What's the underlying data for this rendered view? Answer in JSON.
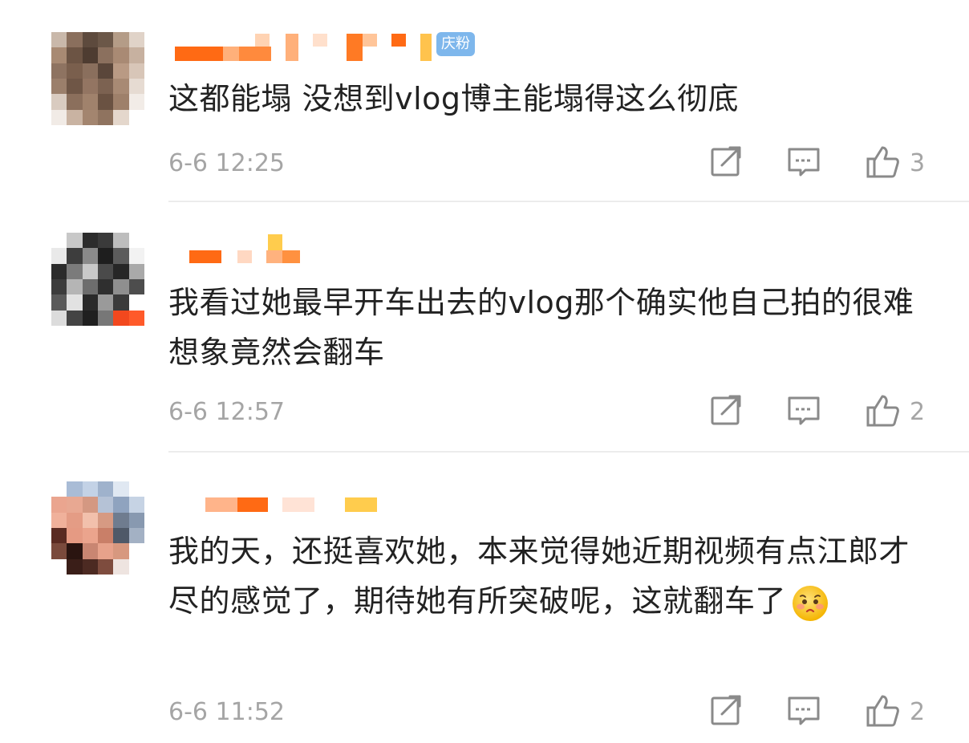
{
  "comments": [
    {
      "badge": "庆粉",
      "text": "这都能塌 没想到vlog博主能塌得这么彻底",
      "time": "6-6 12:25",
      "likes": "3"
    },
    {
      "text": "我看过她最早开车出去的vlog那个确实他自己拍的很难想象竟然会翻车",
      "time": "6-6 12:57",
      "likes": "2"
    },
    {
      "text": "我的天，还挺喜欢她，本来觉得她近期视频有点江郎才尽的感觉了，期待她有所突破呢，这就翻车了",
      "emoji": "sad-face-emoji",
      "time": "6-6 11:52",
      "likes": "2"
    }
  ],
  "icons": {
    "share": "share-icon",
    "reply": "comment-icon",
    "like": "thumbs-up-icon"
  },
  "colors": {
    "badge": "#7eb7ec",
    "meta": "#a5a5a5",
    "nickname_orange": "#ff6a14"
  }
}
